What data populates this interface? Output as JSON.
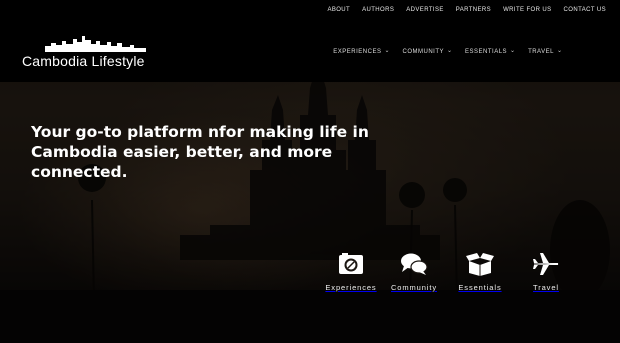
{
  "top_nav": [
    {
      "label": "ABOUT"
    },
    {
      "label": "AUTHORS"
    },
    {
      "label": "ADVERTISE"
    },
    {
      "label": "PARTNERS"
    },
    {
      "label": "WRITE FOR US"
    },
    {
      "label": "CONTACT US"
    }
  ],
  "logo": {
    "text": "Cambodia Lifestyle",
    "icon": "city-skyline-icon"
  },
  "main_nav": [
    {
      "label": "EXPERIENCES",
      "icon": "chevron-down-icon"
    },
    {
      "label": "COMMUNITY",
      "icon": "chevron-down-icon"
    },
    {
      "label": "ESSENTIALS",
      "icon": "chevron-down-icon"
    },
    {
      "label": "TRAVEL",
      "icon": "chevron-down-icon"
    }
  ],
  "hero": {
    "headline": "Your go-to platform nfor making life in Cambodia easier, better, and more connected."
  },
  "categories": [
    {
      "label": "Experiences",
      "icon": "camera-icon"
    },
    {
      "label": "Community",
      "icon": "chat-bubbles-icon"
    },
    {
      "label": "Essentials",
      "icon": "open-box-icon"
    },
    {
      "label": "Travel",
      "icon": "airplane-icon"
    }
  ],
  "colors": {
    "header_bg": "#000000",
    "text": "#ffffff"
  }
}
